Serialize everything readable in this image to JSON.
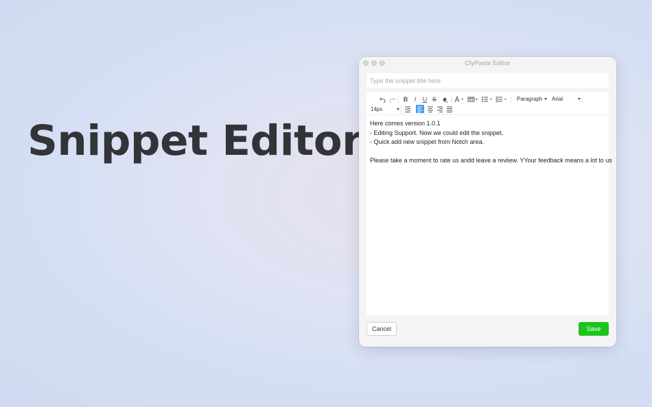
{
  "hero": {
    "title": "Snippet Editor"
  },
  "window": {
    "title": "ClyPaste Editor"
  },
  "snippet_title": {
    "placeholder": "Type the snippet title here",
    "value": ""
  },
  "toolbar": {
    "format_select": "Paragraph",
    "font_select": "Arial",
    "size_select": "14px",
    "icons": [
      "undo-icon",
      "redo-icon",
      "bold-icon",
      "italic-icon",
      "underline-icon",
      "strikethrough-icon",
      "clear-format-icon",
      "font-color-icon",
      "highlight-color-icon",
      "bullet-list-icon",
      "numbered-list-icon",
      "outdent-icon",
      "align-left-icon",
      "align-center-icon",
      "align-right-icon",
      "align-justify-icon"
    ],
    "active_color": "#3d98ee"
  },
  "content": {
    "lines": [
      "Here comes version 1.0.1",
      "- Editing Support. Now we could edit the snippet.",
      "- Quick add new snippet from Notch area.",
      "",
      "Please take a moment to rate us andd leave a reviiew. YYour feedback means a lot to us"
    ]
  },
  "buttons": {
    "cancel": "Cancel",
    "save": "Save",
    "save_color": "#1cc41c"
  }
}
